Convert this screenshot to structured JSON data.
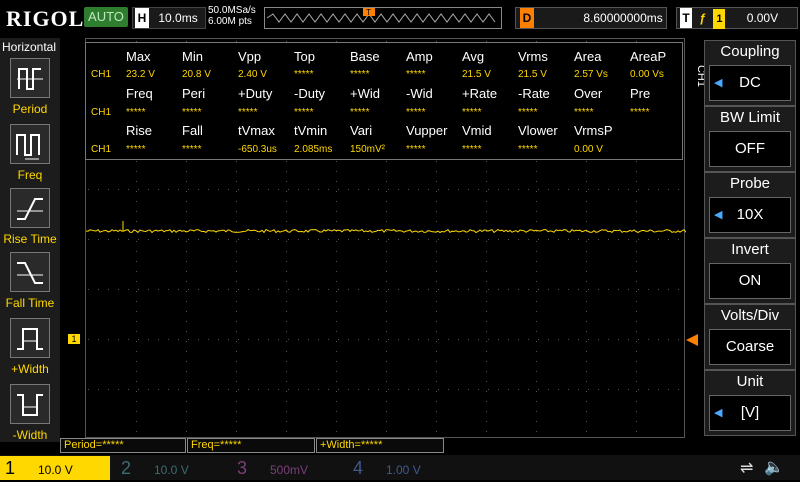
{
  "top_bar": {
    "logo": "RIGOL",
    "run_state": "AUTO",
    "horizontal_tag": "H",
    "timebase": "10.0ms",
    "sample_rate": "50.0MSa/s",
    "memory_points": "6.00M pts",
    "delay_tag": "D",
    "delay": "8.60000000ms",
    "trigger_tag": "T",
    "trigger_source": "1",
    "trigger_level": "0.00V"
  },
  "left_menu": {
    "title": "Horizontal",
    "items": [
      {
        "label": "Period"
      },
      {
        "label": "Freq"
      },
      {
        "label": "Rise Time"
      },
      {
        "label": "Fall Time"
      },
      {
        "label": "+Width"
      },
      {
        "label": "-Width"
      }
    ]
  },
  "measurements": {
    "channel": "CH1",
    "rows": [
      {
        "headers": [
          "Max",
          "Min",
          "Vpp",
          "Top",
          "Base",
          "Amp",
          "Avg",
          "Vrms",
          "Area",
          "AreaP"
        ],
        "values": [
          "23.2 V",
          "20.8 V",
          "2.40 V",
          "*****",
          "*****",
          "*****",
          "21.5 V",
          "21.5 V",
          "2.57 Vs",
          "0.00 Vs"
        ]
      },
      {
        "headers": [
          "Freq",
          "Peri",
          "+Duty",
          "-Duty",
          "+Wid",
          "-Wid",
          "+Rate",
          "-Rate",
          "Over",
          "Pre"
        ],
        "values": [
          "*****",
          "*****",
          "*****",
          "*****",
          "*****",
          "*****",
          "*****",
          "*****",
          "*****",
          "*****"
        ]
      },
      {
        "headers": [
          "Rise",
          "Fall",
          "tVmax",
          "tVmin",
          "Vari",
          "Vupper",
          "Vmid",
          "Vlower",
          "VrmsP",
          ""
        ],
        "values": [
          "*****",
          "*****",
          "-650.3us",
          "2.085ms",
          "150mV²",
          "*****",
          "*****",
          "*****",
          "0.00 V",
          ""
        ]
      }
    ]
  },
  "markers": {
    "ch1": "1"
  },
  "right_panel": {
    "channel_label": "CH1",
    "items": [
      {
        "title": "Coupling",
        "value": "DC"
      },
      {
        "title": "BW Limit",
        "value": "OFF"
      },
      {
        "title": "Probe",
        "value": "10X"
      },
      {
        "title": "Invert",
        "value": "ON"
      },
      {
        "title": "Volts/Div",
        "value": "Coarse"
      },
      {
        "title": "Unit",
        "value": "[V]"
      }
    ]
  },
  "bottom_measures": [
    "Period=*****",
    "Freq=*****",
    "+Width=*****"
  ],
  "channels": [
    {
      "num": "1",
      "scale": "10.0 V",
      "color": "#ffd800",
      "active": true
    },
    {
      "num": "2",
      "scale": "10.0 V",
      "color": "#4fd6e0",
      "active": false
    },
    {
      "num": "3",
      "scale": "500mV",
      "color": "#d040d0",
      "active": false
    },
    {
      "num": "4",
      "scale": "1.00 V",
      "color": "#3a70e8",
      "active": false
    }
  ],
  "colors": {
    "ch1": "#ffd800",
    "trigger": "#ff8000",
    "run": "#2f7d2f"
  }
}
